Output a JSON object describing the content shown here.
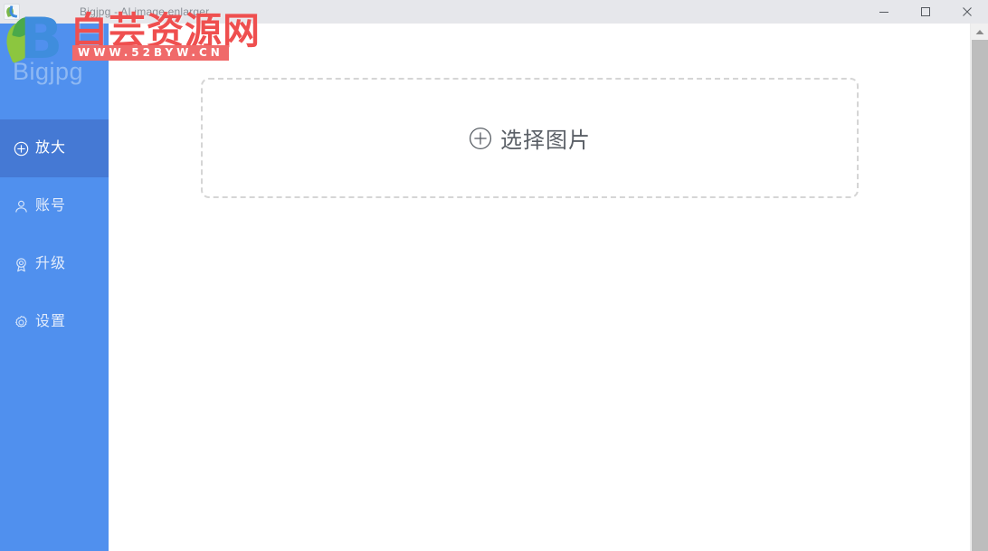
{
  "window": {
    "title": "Bigjpg - AI image enlarger",
    "app_icon": "bigjpg-app-icon",
    "controls": {
      "minimize": "minimize-icon",
      "maximize": "maximize-icon",
      "close": "close-icon"
    }
  },
  "sidebar": {
    "brand": "Bigjpg",
    "items": [
      {
        "label": "放大",
        "icon": "plus-circle-icon",
        "active": true
      },
      {
        "label": "账号",
        "icon": "user-icon",
        "active": false
      },
      {
        "label": "升级",
        "icon": "award-icon",
        "active": false
      },
      {
        "label": "设置",
        "icon": "gear-icon",
        "active": false
      }
    ]
  },
  "main": {
    "dropzone": {
      "label": "选择图片",
      "icon": "plus-circle-icon"
    }
  },
  "scrollbar": {
    "up_arrow": "chevron-up-icon"
  },
  "watermark": {
    "brand_cn": "白芸资源网",
    "url": "WWW.52BYW.CN",
    "logo": "byw-leaf-b-logo"
  },
  "colors": {
    "sidebar": "#5090ee",
    "sidebar_active": "#4579d4",
    "titlebar": "#e6e7eb",
    "dropzone_border": "#d5d5d5",
    "watermark_red": "#ef4f4f"
  }
}
